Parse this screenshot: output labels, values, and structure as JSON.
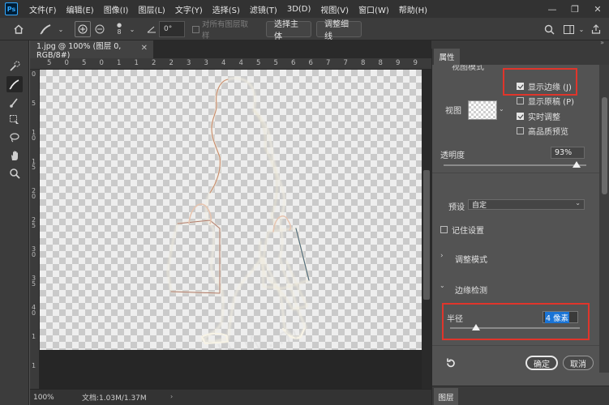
{
  "app": {
    "logo_text": "Ps"
  },
  "menu": [
    "文件(F)",
    "编辑(E)",
    "图像(I)",
    "图层(L)",
    "文字(Y)",
    "选择(S)",
    "滤镜(T)",
    "3D(D)",
    "视图(V)",
    "窗口(W)",
    "帮助(H)"
  ],
  "window_controls": {
    "minimize": "—",
    "maximize": "❐",
    "close": "✕"
  },
  "options_bar": {
    "brush_size": "8",
    "angle_value": "0°",
    "sample_all_layers": "对所有图层取样",
    "select_subject": "选择主体",
    "refine_hair": "调整细线"
  },
  "document": {
    "tab_title": "1.jpg @ 100% (图层 0, RGB/8#)",
    "zoom": "100%",
    "doc_size": "文档:1.03M/1.37M",
    "watermark": "WWW.m"
  },
  "ruler": {
    "top": [
      "5",
      "0",
      "5",
      "0",
      "1",
      "1",
      "2",
      "2",
      "3",
      "3",
      "4",
      "4",
      "5",
      "5",
      "6",
      "6",
      "7",
      "7",
      "8",
      "8",
      "9",
      "9"
    ],
    "left": [
      "0",
      "5",
      "1 0",
      "1 5",
      "2 0",
      "2 5",
      "3 0",
      "3 5",
      "4 0",
      "1",
      "1"
    ]
  },
  "properties": {
    "tab_label": "属性",
    "view_mode_label": "视图模式",
    "view_label": "视图",
    "show_edge": "显示边缘 (J)",
    "show_original": "显示原稿 (P)",
    "realtime_adjust": "实时调整",
    "hq_preview": "高品质预览",
    "opacity_label": "透明度",
    "opacity_value": "93%",
    "opacity_fraction": 0.93,
    "preset_label": "预设",
    "preset_value": "自定",
    "remember_settings": "记住设置",
    "adjust_mode": "调整模式",
    "edge_detection": "边缘检测",
    "radius_label": "半径",
    "radius_value": "4 像素",
    "radius_fraction": 0.2,
    "ok_label": "确定",
    "cancel_label": "取消"
  },
  "checks": {
    "show_edge": true,
    "show_original": false,
    "realtime_adjust": true,
    "hq_preview": false,
    "remember_settings": false
  },
  "layers": {
    "tab_label": "图层"
  },
  "colors": {
    "highlight": "#e0352b",
    "app_bg": "#535353",
    "menubar": "#323232"
  }
}
